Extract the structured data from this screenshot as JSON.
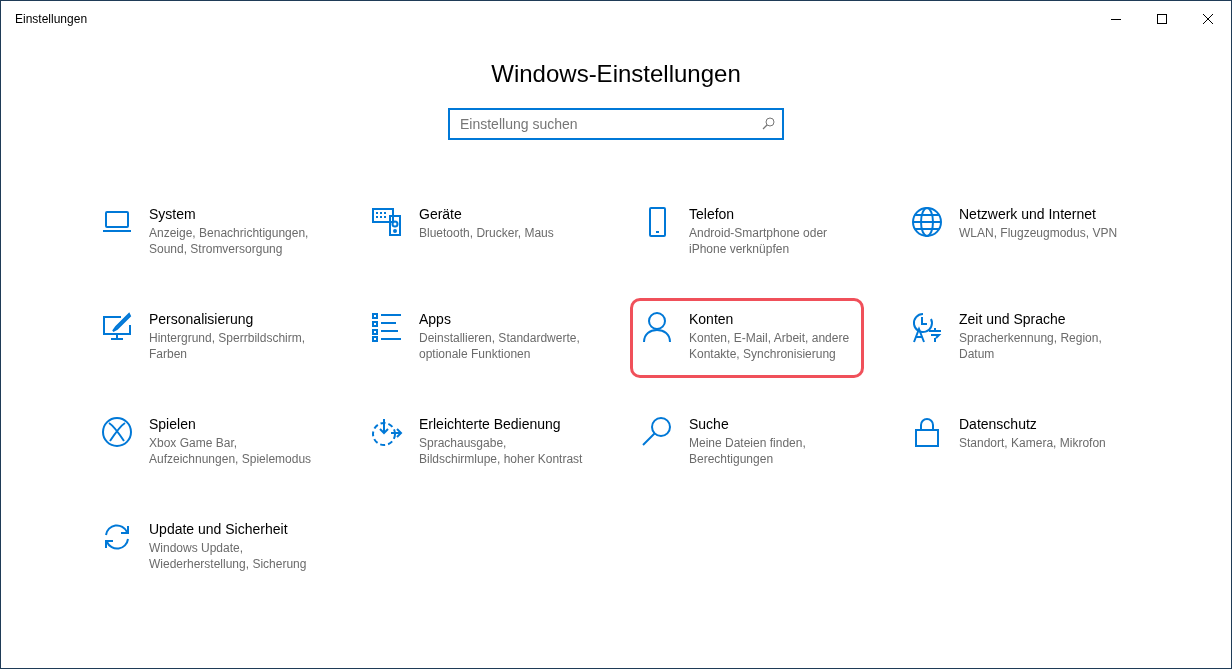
{
  "window": {
    "title": "Einstellungen"
  },
  "heading": "Windows-Einstellungen",
  "search": {
    "placeholder": "Einstellung suchen"
  },
  "categories": [
    {
      "title": "System",
      "description": "Anzeige, Benachrichtigungen, Sound, Stromversorgung",
      "highlighted": false
    },
    {
      "title": "Geräte",
      "description": "Bluetooth, Drucker, Maus",
      "highlighted": false
    },
    {
      "title": "Telefon",
      "description": "Android-Smartphone oder iPhone verknüpfen",
      "highlighted": false
    },
    {
      "title": "Netzwerk und Internet",
      "description": "WLAN, Flugzeugmodus, VPN",
      "highlighted": false
    },
    {
      "title": "Personalisierung",
      "description": "Hintergrund, Sperrbildschirm, Farben",
      "highlighted": false
    },
    {
      "title": "Apps",
      "description": "Deinstallieren, Standardwerte, optionale Funktionen",
      "highlighted": false
    },
    {
      "title": "Konten",
      "description": "Konten, E-Mail, Arbeit, andere Kontakte, Synchronisierung",
      "highlighted": true
    },
    {
      "title": "Zeit und Sprache",
      "description": "Spracherkennung, Region, Datum",
      "highlighted": false
    },
    {
      "title": "Spielen",
      "description": "Xbox Game Bar, Aufzeichnungen, Spielemodus",
      "highlighted": false
    },
    {
      "title": "Erleichterte Bedienung",
      "description": "Sprachausgabe, Bildschirmlupe, hoher Kontrast",
      "highlighted": false
    },
    {
      "title": "Suche",
      "description": "Meine Dateien finden, Berechtigungen",
      "highlighted": false
    },
    {
      "title": "Datenschutz",
      "description": "Standort, Kamera, Mikrofon",
      "highlighted": false
    },
    {
      "title": "Update und Sicherheit",
      "description": "Windows Update, Wiederherstellung, Sicherung",
      "highlighted": false
    }
  ]
}
